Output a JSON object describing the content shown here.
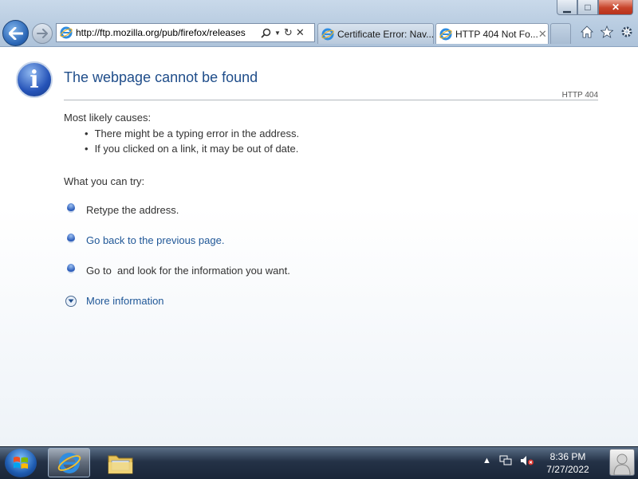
{
  "browser": {
    "address_url": "http://ftp.mozilla.org/pub/firefox/releases",
    "tabs": [
      {
        "title": "Certificate Error: Nav..."
      },
      {
        "title": "HTTP 404 Not Fo..."
      }
    ],
    "tab_close_glyph": "✕"
  },
  "page": {
    "title": "The webpage cannot be found",
    "http_code": "HTTP 404",
    "causes_heading": "Most likely causes:",
    "causes": [
      "There might be a typing error in the address.",
      "If you clicked on a link, it may be out of date."
    ],
    "try_heading": "What you can try:",
    "try_items": [
      {
        "text": "Retype the address.",
        "is_link": false
      },
      {
        "text": "Go back to the previous page.",
        "is_link": true
      },
      {
        "text": "Go to  and look for the information you want.",
        "is_link": false
      }
    ],
    "more_info": "More information"
  },
  "taskbar": {
    "time": "8:36 PM",
    "date": "7/27/2022"
  },
  "colors": {
    "link": "#1f5797",
    "title": "#1f4d8a"
  }
}
